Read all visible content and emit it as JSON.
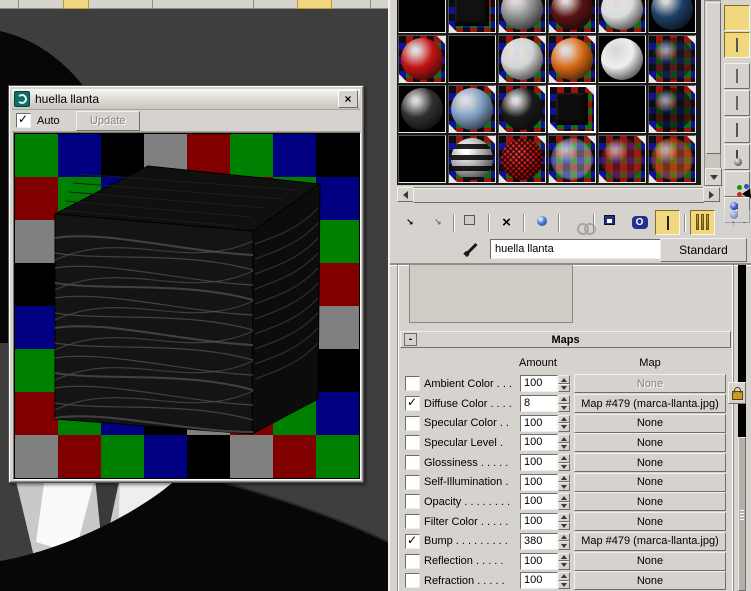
{
  "window": {
    "title": "huella llanta",
    "auto_label": "Auto",
    "update_label": "Update",
    "close_glyph": "×",
    "checker_palette": [
      "#008000",
      "#000080",
      "#000000",
      "#808080",
      "#800000"
    ],
    "grid_size": 8,
    "cube_colors": {
      "top": "#101010",
      "front": "#141414",
      "right": "#0c0c0c",
      "tread_line": "#4a4a4a"
    }
  },
  "viewport": {
    "bg": "#3e3e3e"
  },
  "slots": {
    "selected_index": 15,
    "items": [
      {
        "bg": "black",
        "kind": "none",
        "color": ""
      },
      {
        "bg": "checker",
        "kind": "cube",
        "color": "#111111"
      },
      {
        "bg": "checker",
        "kind": "sphere",
        "color": "#8f8f8f"
      },
      {
        "bg": "checker",
        "kind": "sphere",
        "color": "#5a1212"
      },
      {
        "bg": "checker",
        "kind": "sphere",
        "color": "#dcdcdc"
      },
      {
        "bg": "black",
        "kind": "sphere",
        "color": "#1e3f66"
      },
      {
        "bg": "checker",
        "kind": "sphere",
        "color": "#c41414"
      },
      {
        "bg": "black",
        "kind": "none",
        "color": ""
      },
      {
        "bg": "checker",
        "kind": "sphere",
        "color": "#d4d4d4"
      },
      {
        "bg": "checker",
        "kind": "sphere",
        "color": "#d96a17"
      },
      {
        "bg": "black",
        "kind": "sphere",
        "color": "#efefef"
      },
      {
        "bg": "checker",
        "kind": "trans",
        "color": "rgba(30,30,30,0.55)"
      },
      {
        "bg": "black",
        "kind": "sphere",
        "color": "#303030"
      },
      {
        "bg": "checker",
        "kind": "sphere",
        "color": "#7e9dc2"
      },
      {
        "bg": "checker",
        "kind": "sphere",
        "color": "#1a1a1a"
      },
      {
        "bg": "checker",
        "kind": "cube",
        "color": "#0d0d0d"
      },
      {
        "bg": "black",
        "kind": "none",
        "color": ""
      },
      {
        "bg": "checker",
        "kind": "trans",
        "color": "rgba(15,15,15,0.6)"
      },
      {
        "bg": "black",
        "kind": "none",
        "color": ""
      },
      {
        "bg": "checker",
        "kind": "striped",
        "color": "#a8a8a8"
      },
      {
        "bg": "checker",
        "kind": "wire",
        "color": "#cc1111"
      },
      {
        "bg": "checker",
        "kind": "trans",
        "color": "rgba(205,210,220,0.4)"
      },
      {
        "bg": "checker",
        "kind": "trans",
        "color": "rgba(170,30,30,0.5)"
      },
      {
        "bg": "checker",
        "kind": "trans",
        "color": "rgba(205,95,25,0.5)"
      }
    ]
  },
  "side_toolbar": {
    "items": [
      {
        "name": "sample-type-sphere",
        "kind": "sample-sphere",
        "state": "active"
      },
      {
        "name": "background-checker",
        "kind": "checker",
        "state": "active"
      },
      {
        "name": "sample-uv-tiling",
        "kind": "square",
        "state": "normal"
      },
      {
        "name": "video-color-check",
        "kind": "colorbars",
        "state": "normal"
      },
      {
        "name": "make-preview",
        "kind": "film",
        "state": "normal"
      },
      {
        "name": "options",
        "kind": "slate",
        "state": "normal"
      },
      {
        "name": "select-by-material",
        "kind": "pick",
        "state": "normal"
      },
      {
        "name": "material-map-navigator",
        "kind": "navigator",
        "state": "normal"
      }
    ]
  },
  "mtl_toolbar": {
    "items": [
      {
        "name": "get-material",
        "kind": "sphere-arrow",
        "state": "normal"
      },
      {
        "name": "put-material-to-scene",
        "kind": "sphere-arrow",
        "state": "disabled"
      },
      {
        "name": "sep1",
        "kind": "sep"
      },
      {
        "name": "assign-material-to-selection",
        "kind": "sphere-box",
        "state": "normal"
      },
      {
        "name": "sep2",
        "kind": "sep"
      },
      {
        "name": "reset-map-mtl",
        "kind": "glyph",
        "glyph": "×",
        "state": "normal"
      },
      {
        "name": "sep3",
        "kind": "sep"
      },
      {
        "name": "make-material-copy",
        "kind": "sphere2",
        "state": "normal"
      },
      {
        "name": "sep4",
        "kind": "sep"
      },
      {
        "name": "make-unique",
        "kind": "chain",
        "state": "disabled"
      },
      {
        "name": "sep5",
        "kind": "sep"
      },
      {
        "name": "put-to-library",
        "kind": "sphere-disk",
        "state": "normal"
      },
      {
        "name": "material-id-channel",
        "kind": "oval",
        "glyph": "O",
        "state": "normal"
      },
      {
        "name": "show-map-in-viewport",
        "kind": "cube3d",
        "state": "active"
      },
      {
        "name": "sep6",
        "kind": "sep"
      },
      {
        "name": "show-end-result",
        "kind": "bars",
        "state": "active"
      },
      {
        "name": "go-to-parent",
        "kind": "sphere-up",
        "state": "disabled"
      },
      {
        "name": "go-forward-to-sibling",
        "kind": "sphere-right",
        "state": "disabled"
      }
    ]
  },
  "material": {
    "name": "huella llanta",
    "type": "Standard"
  },
  "maps": {
    "title": "Maps",
    "collapse_glyph": "-",
    "amount_header": "Amount",
    "map_header": "Map",
    "rows": [
      {
        "label": "Ambient Color . . .",
        "checked": false,
        "amount": "100",
        "map": "None",
        "map_disabled": true
      },
      {
        "label": "Diffuse Color . . . .",
        "checked": true,
        "amount": "8",
        "map": "Map #479 (marca-llanta.jpg)",
        "map_disabled": false
      },
      {
        "label": "Specular Color  . .",
        "checked": false,
        "amount": "100",
        "map": "None",
        "map_disabled": false
      },
      {
        "label": "Specular Level  .",
        "checked": false,
        "amount": "100",
        "map": "None",
        "map_disabled": false
      },
      {
        "label": "Glossiness  . . . . .",
        "checked": false,
        "amount": "100",
        "map": "None",
        "map_disabled": false
      },
      {
        "label": "Self-Illumination .",
        "checked": false,
        "amount": "100",
        "map": "None",
        "map_disabled": false
      },
      {
        "label": "Opacity . . . . . . . .",
        "checked": false,
        "amount": "100",
        "map": "None",
        "map_disabled": false
      },
      {
        "label": "Filter Color  . . . . .",
        "checked": false,
        "amount": "100",
        "map": "None",
        "map_disabled": false
      },
      {
        "label": "Bump  . . . . . . . . .",
        "checked": true,
        "amount": "380",
        "map": "Map #479 (marca-llanta.jpg)",
        "map_disabled": false
      },
      {
        "label": "Reflection  . . . . .",
        "checked": false,
        "amount": "100",
        "map": "None",
        "map_disabled": false
      },
      {
        "label": "Refraction  . . . . .",
        "checked": false,
        "amount": "100",
        "map": "None",
        "map_disabled": false
      }
    ]
  }
}
